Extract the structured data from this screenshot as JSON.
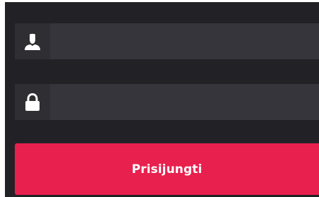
{
  "form": {
    "username": {
      "icon": "user-icon",
      "value": "",
      "placeholder": ""
    },
    "password": {
      "icon": "lock-icon",
      "value": "",
      "placeholder": ""
    },
    "submit_label": "Prisijungti"
  },
  "colors": {
    "panel_bg": "#222226",
    "field_bg": "#35353b",
    "icon_box_bg": "#2e2e33",
    "icon_color": "#ffffff",
    "button_bg": "#e8204e",
    "button_text": "#ffffff"
  }
}
